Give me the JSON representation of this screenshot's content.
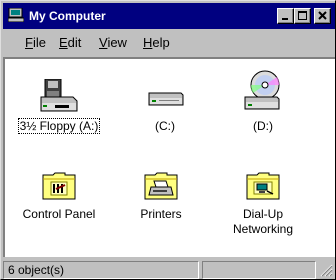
{
  "window": {
    "title": "My Computer",
    "controls": {
      "minimize": "minimize",
      "maximize": "maximize",
      "close": "close"
    }
  },
  "menu": {
    "items": [
      {
        "label_rest": "ile",
        "accel": "F"
      },
      {
        "label_rest": "dit",
        "accel": "E"
      },
      {
        "label_rest": "iew",
        "accel": "V"
      },
      {
        "label_rest": "elp",
        "accel": "H"
      }
    ]
  },
  "icons": [
    {
      "label": "3½ Floppy (A:)",
      "icon": "floppy-drive-icon"
    },
    {
      "label": "(C:)",
      "icon": "hard-drive-icon"
    },
    {
      "label": "(D:)",
      "icon": "cd-drive-icon"
    },
    {
      "label": "Control Panel",
      "icon": "control-panel-folder-icon"
    },
    {
      "label": "Printers",
      "icon": "printers-folder-icon"
    },
    {
      "label": "Dial-Up Networking",
      "label_line1": "Dial-Up",
      "label_line2": "Networking",
      "icon": "dialup-networking-folder-icon"
    }
  ],
  "status": {
    "text": "6 object(s)",
    "secondary": ""
  },
  "colors": {
    "titlebar": "#000080",
    "face": "#c0c0c0",
    "folder": "#ffff80"
  }
}
